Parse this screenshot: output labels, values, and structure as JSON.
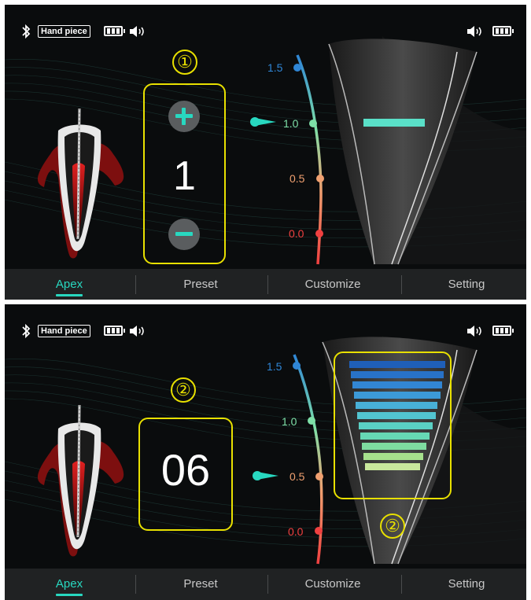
{
  "status_bar": {
    "handpiece_label": "Hand piece"
  },
  "panels": [
    {
      "callout_number": "①",
      "value": "1",
      "scale_labels": [
        "1.5",
        "1.0",
        "0.5",
        "0.0"
      ],
      "pointer_at": "1.0",
      "tabs": [
        {
          "label": "Apex",
          "active": true
        },
        {
          "label": "Preset",
          "active": false
        },
        {
          "label": "Customize",
          "active": false
        },
        {
          "label": "Setting",
          "active": false
        }
      ]
    },
    {
      "callout_number": "②",
      "callout_number_2": "②",
      "value": "06",
      "scale_labels": [
        "1.5",
        "1.0",
        "0.5",
        "0.0"
      ],
      "pointer_at": "0.5",
      "tabs": [
        {
          "label": "Apex",
          "active": true
        },
        {
          "label": "Preset",
          "active": false
        },
        {
          "label": "Customize",
          "active": false
        },
        {
          "label": "Setting",
          "active": false
        }
      ]
    }
  ],
  "colors": {
    "accent": "#28d8c0",
    "callout": "#e8e000",
    "scale_blue": "#2f86d6",
    "scale_green": "#7ee0a8",
    "scale_orange": "#f0a070",
    "scale_red": "#f04040"
  },
  "icons": [
    "bluetooth-icon",
    "battery-icon",
    "speaker-icon",
    "plus-icon",
    "minus-icon",
    "tooth-icon"
  ]
}
